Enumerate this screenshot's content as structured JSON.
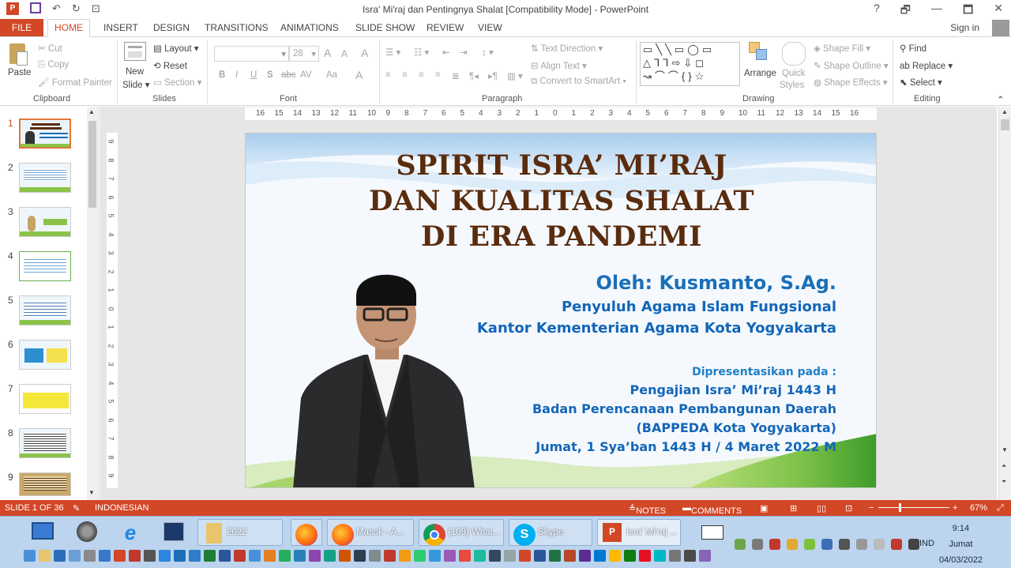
{
  "titlebar": {
    "title": "Isra' Mi'raj dan Pentingnya Shalat [Compatibility Mode] - PowerPoint",
    "help": "?",
    "restore": "🗗",
    "minimize": "—",
    "maximize": "🗖",
    "close": "✕"
  },
  "tabs": {
    "file": "FILE",
    "home": "HOME",
    "insert": "INSERT",
    "design": "DESIGN",
    "transitions": "TRANSITIONS",
    "animations": "ANIMATIONS",
    "slideshow": "SLIDE SHOW",
    "review": "REVIEW",
    "view": "VIEW",
    "signin": "Sign in"
  },
  "ribbon": {
    "clipboard": {
      "paste": "Paste",
      "cut": "Cut",
      "copy": "Copy",
      "format_painter": "Format Painter",
      "label": "Clipboard"
    },
    "slides": {
      "new_slide": "New",
      "new_slide2": "Slide",
      "layout": "Layout",
      "reset": "Reset",
      "section": "Section",
      "label": "Slides"
    },
    "font": {
      "size": "28",
      "bold": "B",
      "italic": "I",
      "underline": "U",
      "shadow": "S",
      "strike": "abc",
      "spacing": "AV",
      "case": "Aa",
      "color": "A",
      "grow": "A",
      "shrink": "A",
      "clear": "A",
      "label": "Font"
    },
    "paragraph": {
      "text_direction": "Text Direction",
      "align_text": "Align Text",
      "convert_smartart": "Convert to SmartArt",
      "label": "Paragraph"
    },
    "drawing": {
      "arrange": "Arrange",
      "quick": "Quick",
      "styles": "Styles",
      "shape_fill": "Shape Fill",
      "shape_outline": "Shape Outline",
      "shape_effects": "Shape Effects",
      "label": "Drawing"
    },
    "editing": {
      "find": "Find",
      "replace": "Replace",
      "select": "Select",
      "label": "Editing"
    }
  },
  "slide_numbers": [
    "1",
    "2",
    "3",
    "4",
    "5",
    "6",
    "7",
    "8",
    "9"
  ],
  "ruler": {
    "h": [
      "16",
      "15",
      "14",
      "13",
      "12",
      "11",
      "10",
      "9",
      "8",
      "7",
      "6",
      "5",
      "4",
      "3",
      "2",
      "1",
      "0",
      "1",
      "2",
      "3",
      "4",
      "5",
      "6",
      "7",
      "8",
      "9",
      "10",
      "11",
      "12",
      "13",
      "14",
      "15",
      "16"
    ],
    "v": [
      "9",
      "8",
      "7",
      "6",
      "5",
      "4",
      "3",
      "2",
      "1",
      "0",
      "1",
      "2",
      "3",
      "4",
      "5",
      "6",
      "7",
      "8",
      "9"
    ]
  },
  "slide": {
    "title1": "SPIRIT ISRA’ MI’RAJ",
    "title2": "DAN KUALITAS SHALAT",
    "title3": "DI ERA PANDEMI",
    "by": "Oleh: Kusmanto, S.Ag.",
    "role": "Penyuluh Agama Islam Fungsional",
    "office": "Kantor Kementerian Agama Kota Yogyakarta",
    "presented": "Dipresentasikan pada :",
    "event": "Pengajian Isra’ Mi’raj 1443 H",
    "agency": "Badan Perencanaan Pembangunan Daerah",
    "agency2": "(BAPPEDA Kota Yogyakarta)",
    "date": "Jumat, 1 Sya’ban 1443 H / 4 Maret 2022 M",
    "colors": {
      "title": "#5a2c0e",
      "name": "#1a6fb8",
      "sub": "#1366b8",
      "presented": "#1e7fc4"
    }
  },
  "status": {
    "slide": "SLIDE 1 OF 36",
    "lang": "INDONESIAN",
    "notes": "NOTES",
    "comments": "COMMENTS",
    "zoom": "67%"
  },
  "taskbar": {
    "folder": "2022",
    "firefox": "Masuk - A...",
    "chrome": "(109) What...",
    "skype": "Skype",
    "ppt": "Isra' Mi'raj ...",
    "lang": "IND",
    "time": "9:14",
    "day": "Jumat",
    "date": "04/03/2022"
  }
}
